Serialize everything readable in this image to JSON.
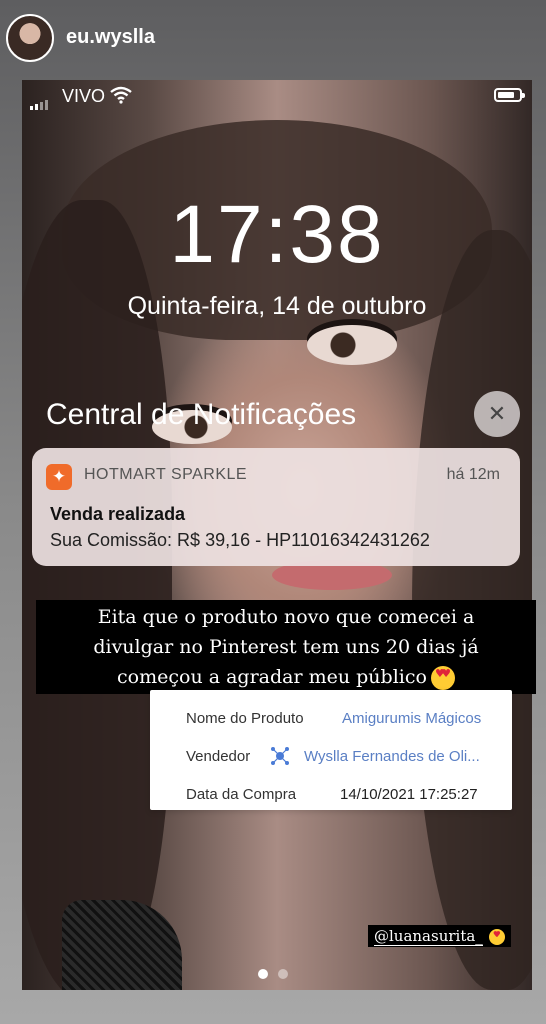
{
  "story": {
    "username": "eu.wyslla",
    "caption_lines": [
      "Eita que o produto novo que comecei a",
      "divulgar no Pinterest tem uns 20 dias já",
      "começou a agradar meu público"
    ],
    "caption_emoji": "heart-eyes-emoji",
    "mention": "@luanasurita_",
    "mention_emoji": "heart-eyes-emoji",
    "page_dots": {
      "count": 2,
      "active": 1
    }
  },
  "lockscreen": {
    "carrier": "VIVO",
    "time": "17:38",
    "date": "Quinta-feira, 14 de outubro",
    "notification_center_title": "Central de Notificações",
    "close_glyph": "✕"
  },
  "notification": {
    "app_name": "HOTMART SPARKLE",
    "time_ago": "há 12m",
    "title": "Venda realizada",
    "body": "Sua Comissão: R$ 39,16 - HP11016342431262"
  },
  "purchase_details": [
    {
      "label": "Nome do Produto",
      "value": "Amigurumis Mágicos"
    },
    {
      "label": "Vendedor",
      "value": "Wyslla Fernandes de Oli..."
    },
    {
      "label": "Data da Compra",
      "value": "14/10/2021 17:25:27"
    }
  ],
  "colors": {
    "hotmart_orange": "#f06b2a",
    "link_blue": "#5a7fc4",
    "caption_bg": "#000000"
  }
}
